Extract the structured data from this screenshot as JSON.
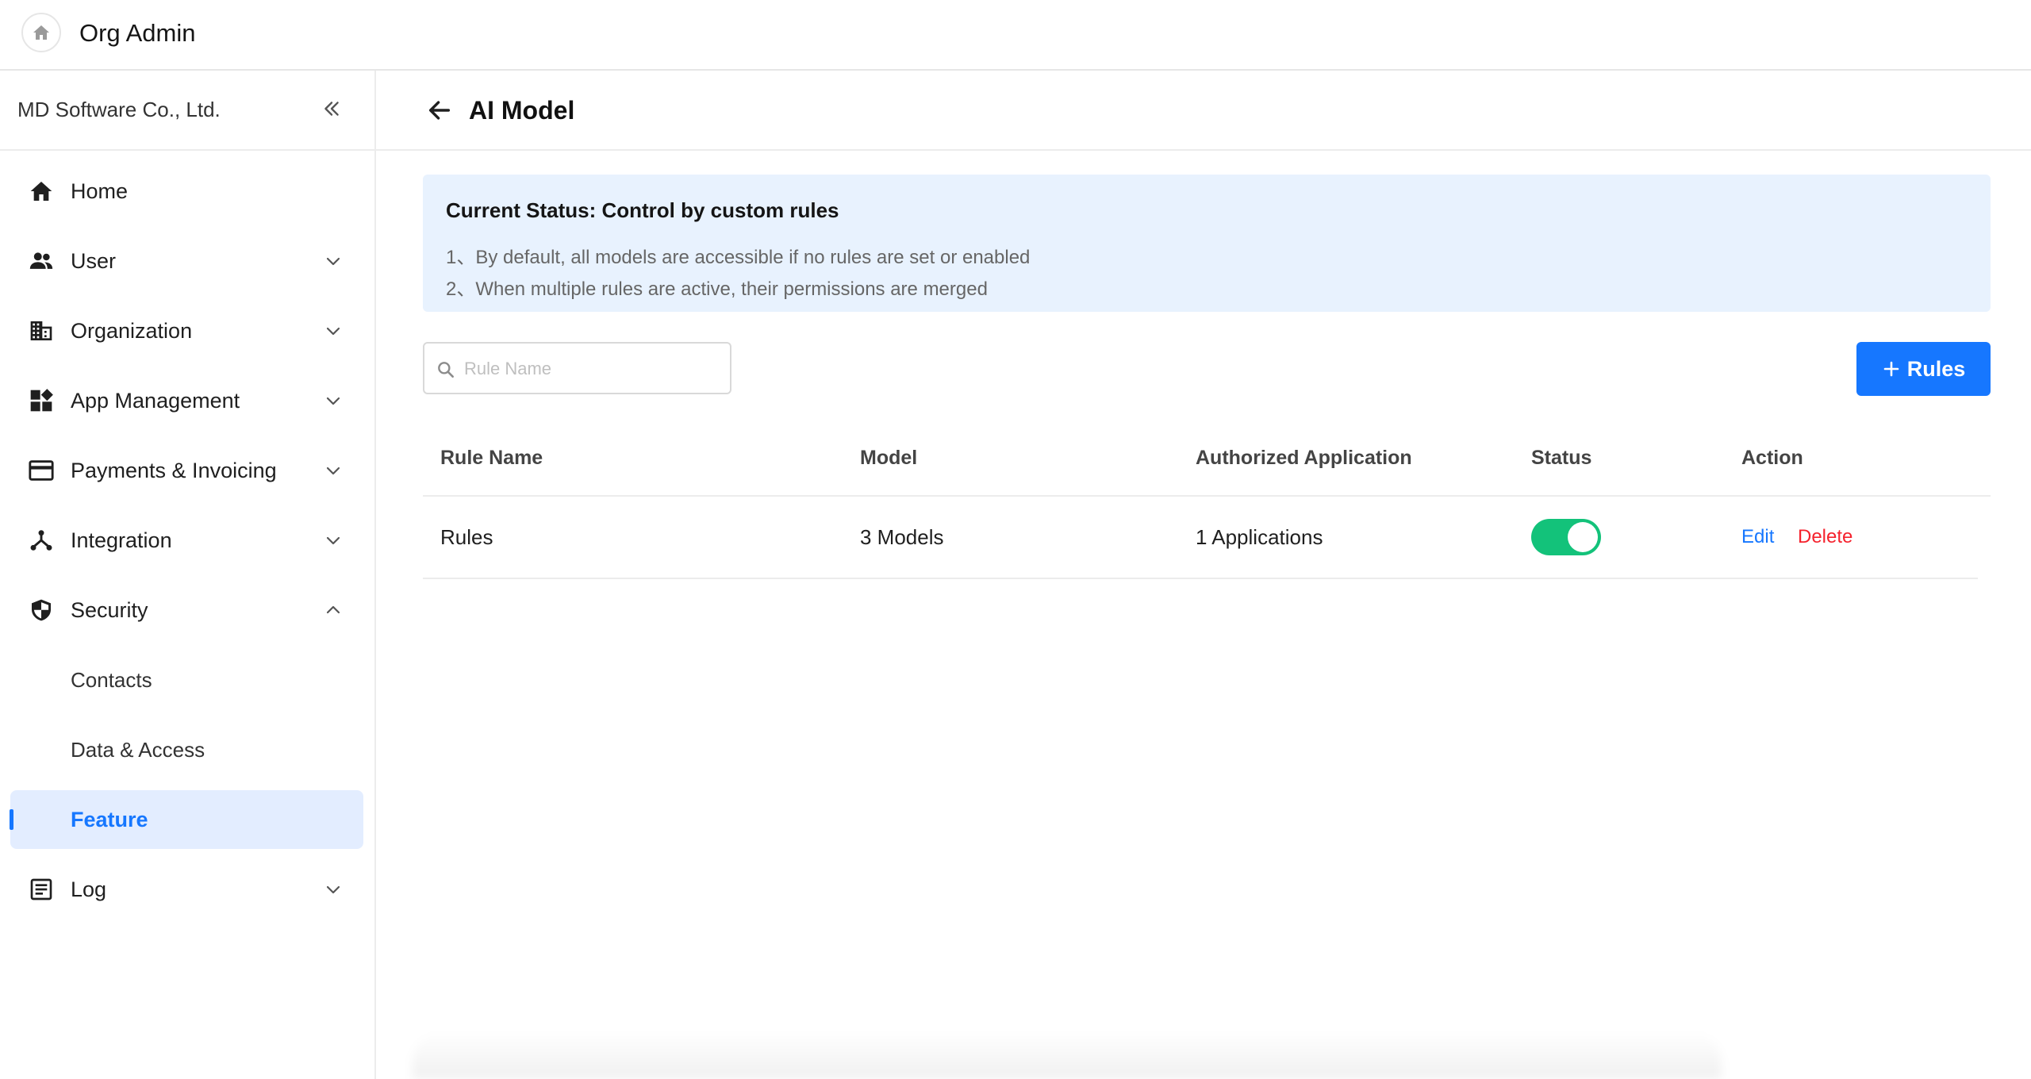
{
  "header": {
    "title": "Org Admin",
    "home_icon": "home-icon"
  },
  "sidebar": {
    "org_name": "MD Software Co., Ltd.",
    "collapse_icon": "double-chevron-left-icon",
    "items": [
      {
        "label": "Home",
        "icon": "home-icon"
      },
      {
        "label": "User",
        "icon": "users-icon",
        "expandable": true
      },
      {
        "label": "Organization",
        "icon": "building-icon",
        "expandable": true
      },
      {
        "label": "App Management",
        "icon": "apps-icon",
        "expandable": true
      },
      {
        "label": "Payments & Invoicing",
        "icon": "credit-card-icon",
        "expandable": true
      },
      {
        "label": "Integration",
        "icon": "integration-icon",
        "expandable": true
      },
      {
        "label": "Security",
        "icon": "shield-icon",
        "expandable": true,
        "expanded": true
      },
      {
        "label": "Log",
        "icon": "log-icon",
        "expandable": true
      }
    ],
    "security_sub": [
      "Contacts",
      "Data & Access",
      "Feature"
    ],
    "active_item": "Feature"
  },
  "page": {
    "title": "AI Model",
    "back_icon": "arrow-left-icon"
  },
  "banner": {
    "title": "Current Status: Control by custom rules",
    "line1": "1、By default, all models are accessible if no rules are set or enabled",
    "line2": "2、When multiple rules are active, their permissions are merged"
  },
  "search": {
    "placeholder": "Rule Name",
    "value": ""
  },
  "add_button": {
    "label": "Rules",
    "icon": "plus-icon"
  },
  "table": {
    "columns": [
      "Rule Name",
      "Model",
      "Authorized Application",
      "Status",
      "Action"
    ],
    "rows": [
      {
        "rule_name": "Rules",
        "model": "3 Models",
        "authorized_application": "1 Applications",
        "status_enabled": true,
        "edit_label": "Edit",
        "delete_label": "Delete"
      }
    ]
  },
  "colors": {
    "accent": "#1677ff",
    "toggle_on": "#13c27a",
    "danger": "#f5222d",
    "banner_bg": "#e8f2fe",
    "active_bg": "#e3edff"
  }
}
